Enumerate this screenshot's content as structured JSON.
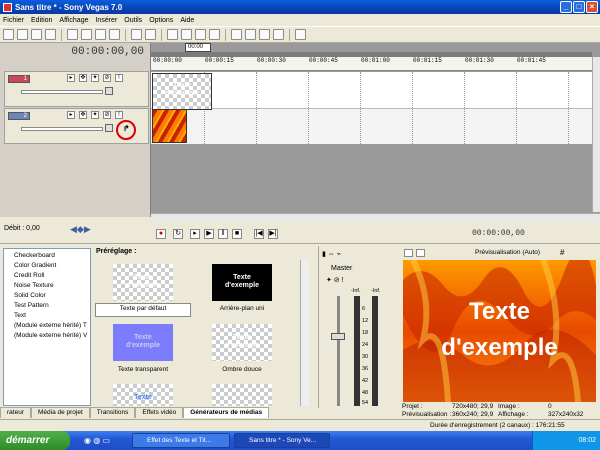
{
  "window": {
    "title": "Sans titre * - Sony Vegas 7.0"
  },
  "menu": [
    "Fichier",
    "Edition",
    "Affichage",
    "Insérer",
    "Outils",
    "Options",
    "Aide"
  ],
  "timecode": "00:00:00,00",
  "cursor_time": "00:00",
  "ruler_ticks": [
    "00:00:00",
    "00:00:15",
    "00:00:30",
    "00:00:45",
    "00:01:00",
    "00:01:15",
    "00:01:30",
    "00:01:45"
  ],
  "tracks": [
    {
      "number": "1",
      "color": "#c84a5a"
    },
    {
      "number": "2",
      "color": "#6e86b5"
    }
  ],
  "clip_text": [
    "Texte",
    "d'exemple"
  ],
  "transport": {
    "debit": "Débit : 0,00",
    "timecode": "00:00:00,00"
  },
  "generators": [
    "Checkerboard",
    "Color Gradient",
    "Credit Roll",
    "Noise Texture",
    "Solid Color",
    "Test Pattern",
    "Text",
    "(Module externe hérité) T",
    "(Module externe hérité) V"
  ],
  "presets": {
    "label": "Préréglage :",
    "items": [
      {
        "name": "Texte par défaut",
        "text": [
          "Texte",
          "d'exemple"
        ]
      },
      {
        "name": "Arrière-plan uni",
        "text": [
          "Texte",
          "d'exemple"
        ]
      },
      {
        "name": "Texte transparent",
        "text": [
          "Texte",
          "d'exemple"
        ]
      },
      {
        "name": "Ombre douce",
        "text": [
          "Texte",
          "d'exemple"
        ]
      },
      {
        "name": "",
        "text": [
          "Texte",
          ""
        ]
      }
    ]
  },
  "master": {
    "label": "Master",
    "left_db": "-Inf.",
    "right_db": "-Inf.",
    "scale": [
      "6",
      "12",
      "18",
      "24",
      "30",
      "36",
      "42",
      "48",
      "54"
    ]
  },
  "preview": {
    "label": "Prévisualisation (Auto)",
    "text_line1": "Texte",
    "text_line2": "d'exemple"
  },
  "preview_info": {
    "projet_label": "Projet :",
    "projet": "720x480; 29,9",
    "image_label": "Image :",
    "image": "0",
    "prev_label": "Prévisualisation :",
    "prev": "360x240; 29,9",
    "aff_label": "Affichage :",
    "aff": "327x240x32"
  },
  "tabs": [
    "rateur",
    "Média de projet",
    "Transitions",
    "Effets vidéo",
    "Générateurs de médias"
  ],
  "status": "Durée d'enregistrement (2 canaux) : 176:21:55",
  "taskbar": {
    "start": "démarrer",
    "items": [
      "Effet des Texte et Tit...",
      "Sans titre * - Sony Ve..."
    ],
    "clock": "08:02"
  }
}
